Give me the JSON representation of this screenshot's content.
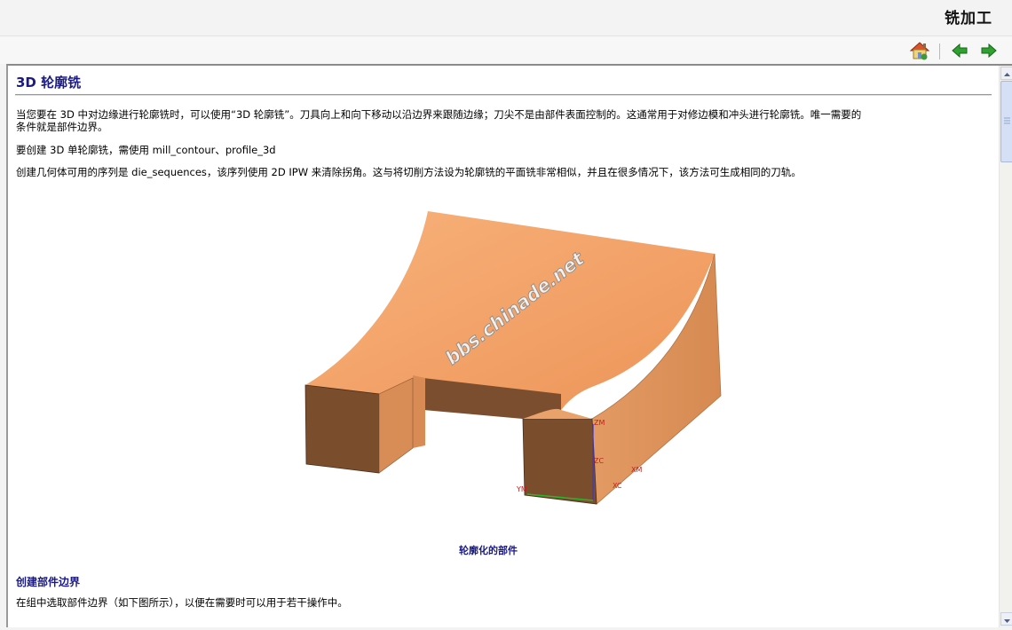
{
  "header": {
    "app_title": "铣加工"
  },
  "toolbar": {
    "home_icon": "home-icon",
    "back_icon": "arrow-left-icon",
    "forward_icon": "arrow-right-icon"
  },
  "article": {
    "title": "3D 轮廓铣",
    "paragraph1_line1": "当您要在 3D 中对边缘进行轮廓铣时，可以使用“3D 轮廓铣”。刀具向上和向下移动以沿边界来跟随边缘；刀尖不是由部件表面控制的。这通常用于对修边模和冲头进行轮廓铣。唯一需要的",
    "paragraph1_line2": "条件就是部件边界。",
    "paragraph2": "要创建 3D 单轮廓铣，需使用 mill_contour、profile_3d",
    "paragraph3": "创建几何体可用的序列是 die_sequences，该序列使用 2D IPW 来清除拐角。这与将切削方法设为轮廓铣的平面铣非常相似，并且在很多情况下，该方法可生成相同的刀轨。",
    "figure": {
      "watermark": "bbs.chinade.net",
      "axis_labels": {
        "zm": "ZM",
        "zc": "ZC",
        "xm": "XM",
        "xc": "XC",
        "ym": "YM"
      },
      "caption": "轮廓化的部件"
    },
    "section_heading": "创建部件边界",
    "section_paragraph": "在组中选取部件边界（如下图所示），以便在需要时可以用于若干操作中。"
  },
  "colors": {
    "heading": "#1a1a80",
    "part_top": "#f0a868",
    "part_side": "#7a4e2e"
  }
}
